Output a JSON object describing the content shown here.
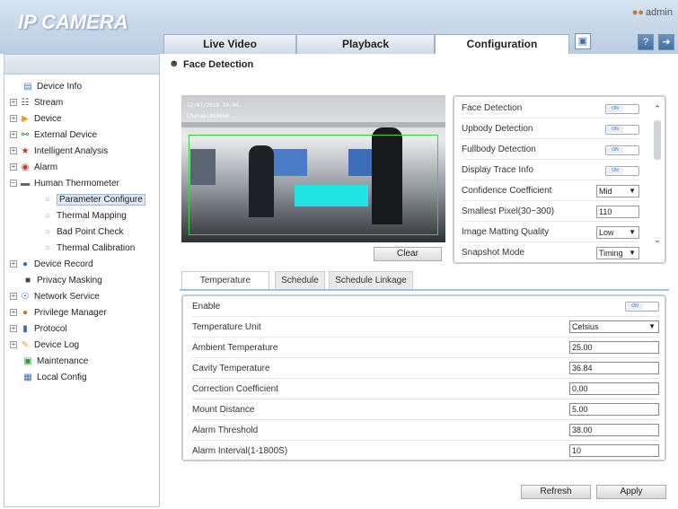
{
  "app": {
    "title": "IP CAMERA",
    "user": "admin"
  },
  "tabs": [
    {
      "label": "Live Video"
    },
    {
      "label": "Playback"
    },
    {
      "label": "Configuration"
    }
  ],
  "sidebar": {
    "items": [
      {
        "label": "Device Info",
        "icon": "document-icon"
      },
      {
        "label": "Stream",
        "icon": "stream-icon"
      },
      {
        "label": "Device",
        "icon": "folder-icon"
      },
      {
        "label": "External Device",
        "icon": "plug-icon"
      },
      {
        "label": "Intelligent Analysis",
        "icon": "analysis-icon"
      },
      {
        "label": "Alarm",
        "icon": "alarm-icon"
      },
      {
        "label": "Human Thermometer",
        "icon": "thermometer-icon"
      },
      {
        "label": "Parameter Configure",
        "icon": "circle-icon"
      },
      {
        "label": "Thermal Mapping",
        "icon": "circle-icon"
      },
      {
        "label": "Bad Point Check",
        "icon": "circle-icon"
      },
      {
        "label": "Thermal Calibration",
        "icon": "circle-icon"
      },
      {
        "label": "Device Record",
        "icon": "record-icon"
      },
      {
        "label": "Privacy Masking",
        "icon": "mask-icon"
      },
      {
        "label": "Network Service",
        "icon": "network-icon"
      },
      {
        "label": "Privilege Manager",
        "icon": "users-icon"
      },
      {
        "label": "Protocol",
        "icon": "protocol-icon"
      },
      {
        "label": "Device Log",
        "icon": "log-icon"
      },
      {
        "label": "Maintenance",
        "icon": "maintenance-icon"
      },
      {
        "label": "Local Config",
        "icon": "config-icon"
      }
    ]
  },
  "page": {
    "title": "Face Detection"
  },
  "video": {
    "timestamp": "12/07/2018 10:44:",
    "channel": "Chunaa1066666..."
  },
  "clear_label": "Clear",
  "face_panel": {
    "face_detection": {
      "label": "Face Detection",
      "value": "ON"
    },
    "upbody_detection": {
      "label": "Upbody Detection",
      "value": "ON"
    },
    "fullbody_detection": {
      "label": "Fullbody Detection",
      "value": "ON"
    },
    "display_trace": {
      "label": "Display Trace Info",
      "value": "ON"
    },
    "confidence": {
      "label": "Confidence Coefficient",
      "value": "Mid"
    },
    "smallest_pixel": {
      "label": "Smallest Pixel(30~300)",
      "value": "110"
    },
    "matting_quality": {
      "label": "Image Matting Quality",
      "value": "Low"
    },
    "snapshot_mode": {
      "label": "Snapshot Mode",
      "value": "Timing"
    }
  },
  "subtabs": [
    {
      "label": "Temperature"
    },
    {
      "label": "Schedule"
    },
    {
      "label": "Schedule Linkage"
    }
  ],
  "temperature": {
    "enable": {
      "label": "Enable",
      "value": "ON"
    },
    "unit": {
      "label": "Temperature Unit",
      "value": "Celsius"
    },
    "ambient": {
      "label": "Ambient Temperature",
      "value": "25.00"
    },
    "cavity": {
      "label": "Cavity Temperature",
      "value": "36.84"
    },
    "correction": {
      "label": "Correction Coefficient",
      "value": "0.00"
    },
    "mount": {
      "label": "Mount Distance",
      "value": "5.00"
    },
    "alarm_threshold": {
      "label": "Alarm Threshold",
      "value": "38.00"
    },
    "alarm_interval": {
      "label": "Alarm Interval(1-1800S)",
      "value": "10"
    }
  },
  "buttons": {
    "refresh": "Refresh",
    "apply": "Apply"
  }
}
